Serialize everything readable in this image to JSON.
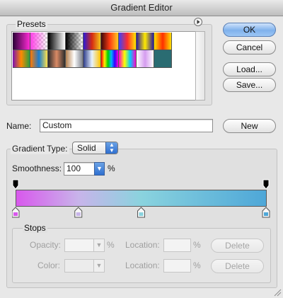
{
  "window": {
    "title": "Gradient Editor"
  },
  "presets": {
    "label": "Presets",
    "menu_icon": "circle-arrow-right-icon",
    "swatches": [
      "linear-gradient(to right,#2a0036,#ff2bd6)",
      "linear-gradient(to right,#ff40e6,transparent)",
      "linear-gradient(to right,#000000,#ffffff)",
      "linear-gradient(to right,#000000,transparent)",
      "linear-gradient(to right,#2a1ad8,#d62a12,#f2c31a)",
      "linear-gradient(to right,#3b0a0a,#ff3b12,#ffcc22)",
      "linear-gradient(to right,#3a42ff,#ff2e2e,#ffe800)",
      "linear-gradient(to right,#2a1b9e,#ffea00,#2a1b9e)",
      "linear-gradient(to right,#ffe000,#ff2e00,#ffe000)",
      "linear-gradient(to right,#7a12b0,#ff8a00,#2a9d40)",
      "linear-gradient(to right,#ff7a00,#1b7dd0,#ffe14a)",
      "linear-gradient(to right,#2c2c2c,#d98a65,#2c2c2c)",
      "linear-gradient(to right,#b48050,#ffffff,#7a7f8a)",
      "linear-gradient(to right,#2e3c8a,#e6f2ff,#ffc300)",
      "linear-gradient(to right,#ff0000,#ffee00,#00d000,#00b3ff,#3000ff,#ff00d0)",
      "linear-gradient(to right,#ff00cc,#ffff00,#00ccff,#ff00cc)",
      "linear-gradient(to right,#ffffff,#d59cf0,#ffffff)",
      "linear-gradient(to right,#2a6c72,#2a6c72)"
    ]
  },
  "buttons": {
    "ok": "OK",
    "cancel": "Cancel",
    "load": "Load...",
    "save": "Save...",
    "new": "New"
  },
  "name": {
    "label": "Name:",
    "value": "Custom"
  },
  "gradient_type": {
    "label": "Gradient Type:",
    "value": "Solid"
  },
  "smoothness": {
    "label": "Smoothness:",
    "value": "100",
    "unit": "%"
  },
  "gradient": {
    "colors": [
      "#d858ec",
      "#c8b4ea",
      "#8ad3de",
      "#4ea7d8"
    ],
    "color_stop_locations_percent": [
      0,
      25,
      50,
      100
    ],
    "opacity_stop_locations_percent": [
      0,
      100
    ]
  },
  "stops": {
    "label": "Stops",
    "opacity_label": "Opacity:",
    "opacity_value": "",
    "opacity_unit": "%",
    "color_label": "Color:",
    "location_label": "Location:",
    "location_opacity_value": "",
    "location_color_value": "",
    "location_unit": "%",
    "delete_label": "Delete"
  }
}
